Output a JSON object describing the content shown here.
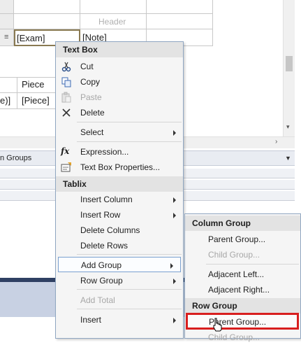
{
  "designer": {
    "header_text": "Header",
    "exam_cell": "[Exam]",
    "note_cell": "[Note]",
    "piece_label": "Piece",
    "value_cell": "e)]",
    "piece_cell": "[Piece]",
    "groups_label": "n Groups"
  },
  "context_menu": {
    "textbox_header": "Text Box",
    "textbox_items": [
      {
        "label": "Cut",
        "icon": "scissors-icon"
      },
      {
        "label": "Copy",
        "icon": "copy-icon"
      },
      {
        "label": "Paste",
        "icon": "paste-icon",
        "disabled": true
      },
      {
        "label": "Delete",
        "icon": "delete-x-icon"
      }
    ],
    "select_label": "Select",
    "expression_label": "Expression...",
    "textbox_props_label": "Text Box Properties...",
    "tablix_header": "Tablix",
    "insert_column_label": "Insert Column",
    "insert_row_label": "Insert Row",
    "delete_columns_label": "Delete Columns",
    "delete_rows_label": "Delete Rows",
    "add_group_label": "Add Group",
    "row_group_label": "Row Group",
    "add_total_label": "Add Total",
    "insert_label": "Insert"
  },
  "submenu": {
    "column_group_header": "Column Group",
    "col_parent_group": "Parent Group...",
    "col_child_group": "Child Group...",
    "adjacent_left": "Adjacent Left...",
    "adjacent_right": "Adjacent Right...",
    "row_group_header": "Row Group",
    "row_parent_group": "Parent Group...",
    "row_child_group": "Child Group..."
  },
  "colors": {
    "menu_border": "#8fa6c1",
    "highlight_border": "#7aa0cf",
    "callout_red": "#d81e1e",
    "dark_band": "#2f4063"
  }
}
